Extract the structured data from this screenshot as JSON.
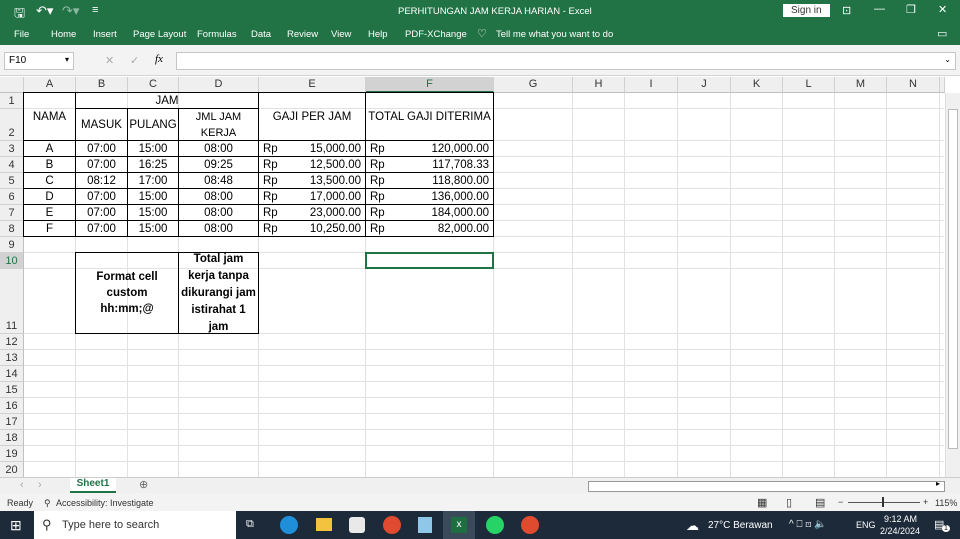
{
  "title": "PERHITUNGAN JAM KERJA HARIAN  -  Excel",
  "sign_in": "Sign in",
  "ribbon_tabs": [
    "File",
    "Home",
    "Insert",
    "Page Layout",
    "Formulas",
    "Data",
    "Review",
    "View",
    "Help",
    "PDF-XChange"
  ],
  "tell_me": "Tell me what you want to do",
  "name_box": "F10",
  "fx_label": "fx",
  "columns": [
    "A",
    "B",
    "C",
    "D",
    "E",
    "F",
    "G",
    "H",
    "I",
    "J",
    "K",
    "L",
    "M",
    "N"
  ],
  "rows": [
    "1",
    "2",
    "3",
    "4",
    "5",
    "6",
    "7",
    "8",
    "9",
    "10",
    "11",
    "12",
    "13",
    "14",
    "15",
    "16",
    "17",
    "18",
    "19",
    "20"
  ],
  "headers": {
    "nama": "NAMA",
    "jam": "JAM",
    "masuk": "MASUK",
    "pulang": "PULANG",
    "jml": "JML JAM KERJA",
    "gaji": "GAJI PER JAM",
    "total": "TOTAL GAJI DITERIMA"
  },
  "currency": "Rp",
  "table": [
    {
      "nama": "A",
      "masuk": "07:00",
      "pulang": "15:00",
      "jml": "08:00",
      "gaji": "15,000.00",
      "total": "120,000.00"
    },
    {
      "nama": "B",
      "masuk": "07:00",
      "pulang": "16:25",
      "jml": "09:25",
      "gaji": "12,500.00",
      "total": "117,708.33"
    },
    {
      "nama": "C",
      "masuk": "08:12",
      "pulang": "17:00",
      "jml": "08:48",
      "gaji": "13,500.00",
      "total": "118,800.00"
    },
    {
      "nama": "D",
      "masuk": "07:00",
      "pulang": "15:00",
      "jml": "08:00",
      "gaji": "17,000.00",
      "total": "136,000.00"
    },
    {
      "nama": "E",
      "masuk": "07:00",
      "pulang": "15:00",
      "jml": "08:00",
      "gaji": "23,000.00",
      "total": "184,000.00"
    },
    {
      "nama": "F",
      "masuk": "07:00",
      "pulang": "15:00",
      "jml": "08:00",
      "gaji": "10,250.00",
      "total": "82,000.00"
    }
  ],
  "notes": {
    "left": "Format cell custom hh:mm;@",
    "right": "Total jam kerja tanpa dikurangi jam istirahat 1 jam"
  },
  "sheet_tab": "Sheet1",
  "status": {
    "ready": "Ready",
    "accessibility": "Accessibility: Investigate",
    "zoom": "115%"
  },
  "taskbar": {
    "search": "Type here to search",
    "weather": "27°C  Berawan",
    "lang": "ENG",
    "time": "9:12 AM",
    "date": "2/24/2024",
    "notif": "1"
  },
  "colors": {
    "excel_green": "#217346",
    "taskbar": "#1c2a3a"
  }
}
